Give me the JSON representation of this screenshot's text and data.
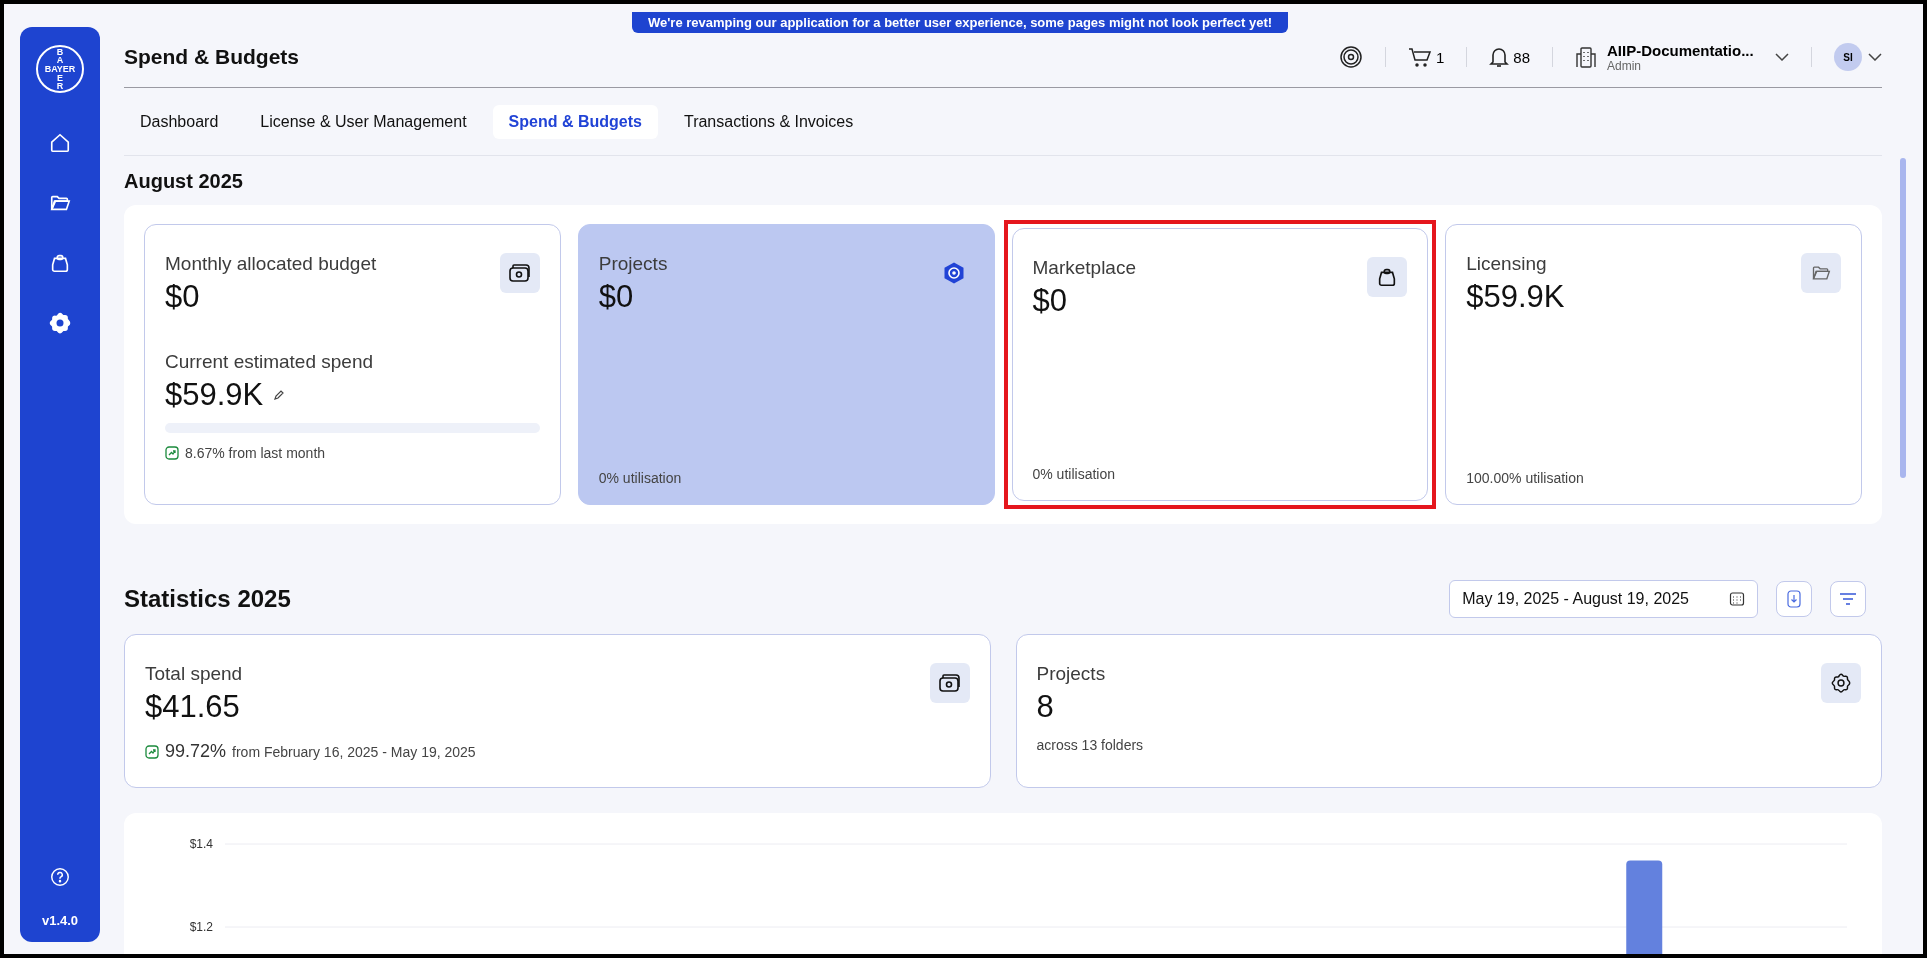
{
  "banner": {
    "text": "We're revamping our application for a better user experience, some pages might not look perfect yet!"
  },
  "sidebar": {
    "logo": {
      "horizontal": "BAYER",
      "vertical_top": "BA",
      "vertical_bottom": "ER"
    },
    "items": [
      {
        "kind": "home",
        "selected": false
      },
      {
        "kind": "folder",
        "selected": false
      },
      {
        "kind": "bag",
        "selected": false
      },
      {
        "kind": "gear",
        "selected": true
      }
    ],
    "version": "v1.4.0"
  },
  "header": {
    "title": "Spend & Budgets",
    "cart_count": "1",
    "notification_count": "88",
    "organization": {
      "name": "AIIP-Documentatio...",
      "role": "Admin"
    },
    "avatar": "SI"
  },
  "tabs": [
    {
      "label": "Dashboard",
      "selected": false
    },
    {
      "label": "License & User Management",
      "selected": false
    },
    {
      "label": "Spend & Budgets",
      "selected": true
    },
    {
      "label": "Transactions & Invoices",
      "selected": false
    }
  ],
  "month": {
    "title": "August 2025",
    "cards": [
      {
        "kind": "budget",
        "label": "Monthly allocated budget",
        "value": "$0",
        "sub_label": "Current estimated spend",
        "sub_value": "$59.9K",
        "level": 0,
        "trend": "8.67% from last month",
        "selected": false,
        "highlighted": false
      },
      {
        "kind": "projects",
        "label": "Projects",
        "value": "$0",
        "utilisation": "0% utilisation",
        "selected": true,
        "highlighted": false
      },
      {
        "kind": "marketplace",
        "label": "Marketplace",
        "value": "$0",
        "utilisation": "0% utilisation",
        "selected": false,
        "highlighted": true
      },
      {
        "kind": "licensing",
        "label": "Licensing",
        "value": "$59.9K",
        "utilisation": "100.00% utilisation",
        "selected": false,
        "highlighted": false
      }
    ]
  },
  "statistics": {
    "title": "Statistics 2025",
    "date_range": "May 19, 2025 - August 19, 2025",
    "cards": [
      {
        "kind": "spend",
        "label": "Total spend",
        "value": "$41.65",
        "trend_value": "99.72%",
        "trend_text": "from February 16, 2025 - May 19, 2025"
      },
      {
        "kind": "projects",
        "label": "Projects",
        "value": "8",
        "note": "across 13 folders"
      }
    ],
    "chart_data": {
      "type": "bar",
      "ylim": [
        0.95,
        1.4
      ],
      "yticks": [
        {
          "value": 1.2,
          "label": "$1.2"
        },
        {
          "value": 1.4,
          "label": "$1.4"
        }
      ],
      "values": [
        null,
        null,
        null,
        1.36
      ]
    }
  }
}
